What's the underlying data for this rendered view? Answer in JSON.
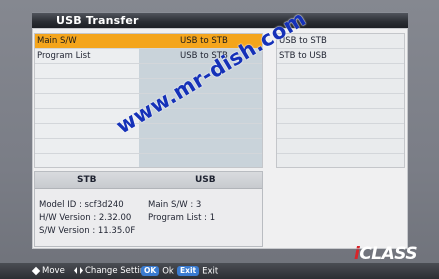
{
  "window": {
    "title": "USB Transfer"
  },
  "list": {
    "rows": [
      {
        "name": "Main S/W",
        "value": "USB to STB",
        "selected": true
      },
      {
        "name": "Program List",
        "value": "USB to STB",
        "selected": false
      }
    ],
    "empty_row_count": 6
  },
  "options": {
    "items": [
      "USB to STB",
      "STB to USB"
    ],
    "empty_row_count": 6
  },
  "info": {
    "stb_header": "STB",
    "usb_header": "USB",
    "stb": {
      "model_id": "Model ID : scf3d240",
      "hw_version": "H/W Version : 2.32.00",
      "sw_version": "S/W Version : 11.35.0F"
    },
    "usb": {
      "main_sw": "Main S/W : 3",
      "program_list": "Program List : 1"
    }
  },
  "watermark": "www.mr-dish.com",
  "brand": {
    "first_letter": "i",
    "rest": "CLASS"
  },
  "footer": {
    "move": "Move",
    "change_setting": "Change Setting",
    "ok_key": "OK",
    "ok": "Ok",
    "exit_key": "Exit",
    "exit": "Exit"
  },
  "colors": {
    "highlight": "#f4a51c",
    "title_bar": "#2a2d33",
    "watermark": "#1531b8",
    "brand_accent": "#d8252a"
  }
}
